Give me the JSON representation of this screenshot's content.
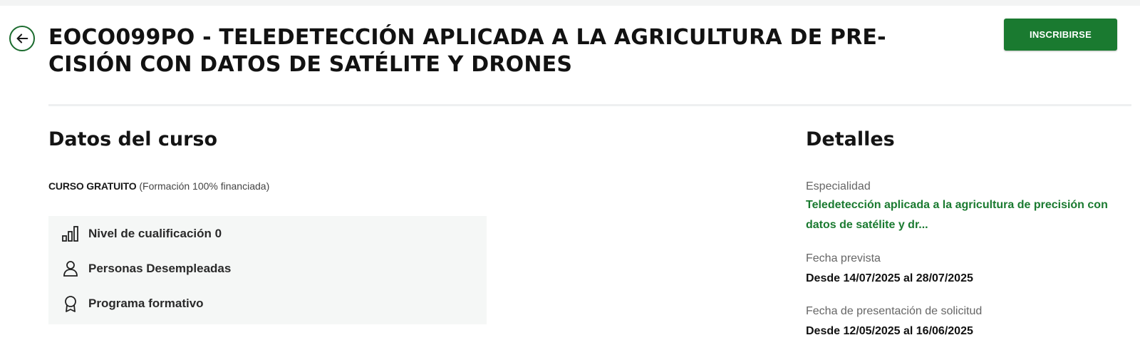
{
  "header": {
    "title": "EOCO099PO - TELEDETECCIÓN APLICADA A LA AGRICULTURA DE PRE-CISIÓN CON DATOS DE SATÉLITE Y DRONES",
    "enroll_label": "INSCRIBIRSE"
  },
  "course": {
    "section_title": "Datos del curso",
    "price_label": "CURSO GRATUITO",
    "price_note": " (Formación 100% financiada)",
    "features": [
      {
        "icon": "bar-chart-icon",
        "label": "Nivel de cualificación 0"
      },
      {
        "icon": "person-icon",
        "label": "Personas Desempleadas"
      },
      {
        "icon": "award-icon",
        "label": "Programa formativo"
      }
    ]
  },
  "details": {
    "section_title": "Detalles",
    "specialty_label": "Especialidad",
    "specialty_value": "Teledetección aplicada a la agricultura de precisión con datos de satélite y dr...",
    "date_label": "Fecha prevista",
    "date_value": "Desde 14/07/2025 al 28/07/2025",
    "application_label": "Fecha de presentación de solicitud",
    "application_value": "Desde 12/05/2025 al 16/06/2025"
  },
  "colors": {
    "accent": "#1a7a30",
    "feature_bg": "#f5f7f6"
  }
}
